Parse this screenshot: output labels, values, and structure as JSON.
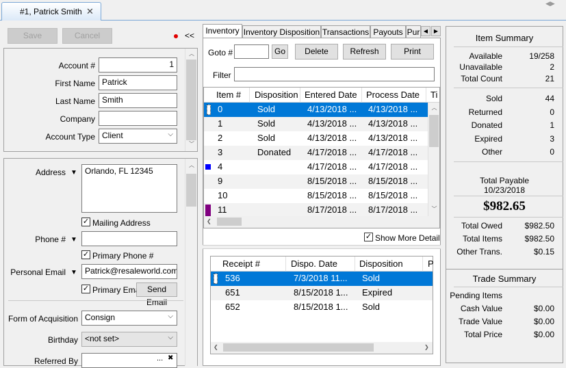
{
  "document_tab": {
    "title": "#1, Patrick Smith"
  },
  "left": {
    "save_label": "Save",
    "cancel_label": "Cancel",
    "collapse_label": "<<",
    "account_number_label": "Account #",
    "account_number_value": "1",
    "first_name_label": "First Name",
    "first_name_value": "Patrick",
    "last_name_label": "Last Name",
    "last_name_value": "Smith",
    "company_label": "Company",
    "company_value": "",
    "account_type_label": "Account Type",
    "account_type_value": "Client",
    "address_label": "Address",
    "address_value": "Orlando, FL  12345",
    "mailing_address_label": "Mailing Address",
    "phone_label": "Phone #",
    "phone_value": "",
    "primary_phone_label": "Primary Phone #",
    "personal_email_label": "Personal Email",
    "personal_email_value": "Patrick@resaleworld.com",
    "primary_email_label": "Primary Email",
    "send_email_label": "Send Email",
    "form_of_acquisition_label": "Form of Acquisition",
    "form_of_acquisition_value": "Consign",
    "birthday_label": "Birthday",
    "birthday_value": "<not set>",
    "referred_by_label": "Referred By",
    "referred_by_value": "",
    "ellipsis": "...",
    "clear": "✖"
  },
  "middle": {
    "tabs": [
      "Inventory",
      "Inventory Disposition",
      "Transactions",
      "Payouts",
      "Pur"
    ],
    "goto_label": "Goto #",
    "goto_value": "",
    "go_label": "Go",
    "delete_label": "Delete",
    "refresh_label": "Refresh",
    "print_label": "Print",
    "filter_label": "Filter",
    "filter_value": "",
    "inventory_columns": [
      "Item #",
      "Disposition",
      "Entered Date",
      "Process Date",
      "Ti"
    ],
    "inventory_rows": [
      {
        "item": "0",
        "disposition": "Sold",
        "entered": "4/13/2018 ...",
        "process": "4/13/2018 ..."
      },
      {
        "item": "1",
        "disposition": "Sold",
        "entered": "4/13/2018 ...",
        "process": "4/13/2018 ..."
      },
      {
        "item": "2",
        "disposition": "Sold",
        "entered": "4/13/2018 ...",
        "process": "4/13/2018 ..."
      },
      {
        "item": "3",
        "disposition": "Donated",
        "entered": "4/17/2018 ...",
        "process": "4/17/2018 ..."
      },
      {
        "item": "4",
        "disposition": "",
        "entered": "4/17/2018 ...",
        "process": "4/17/2018 ..."
      },
      {
        "item": "9",
        "disposition": "",
        "entered": "8/15/2018 ...",
        "process": "8/15/2018 ..."
      },
      {
        "item": "10",
        "disposition": "",
        "entered": "8/15/2018 ...",
        "process": "8/15/2018 ..."
      },
      {
        "item": "11",
        "disposition": "",
        "entered": "8/17/2018 ...",
        "process": "8/17/2018 ..."
      }
    ],
    "row_marker_colors": {
      "4": "#0000ff",
      "11": "#800080"
    },
    "show_more_detail_label": "Show More Detail",
    "receipt_columns": [
      "Receipt #",
      "Dispo. Date",
      "Disposition",
      "P"
    ],
    "receipt_rows": [
      {
        "receipt": "536",
        "date": "7/3/2018 11...",
        "disposition": "Sold"
      },
      {
        "receipt": "651",
        "date": "8/15/2018 1...",
        "disposition": "Expired"
      },
      {
        "receipt": "652",
        "date": "8/15/2018 1...",
        "disposition": "Sold"
      }
    ]
  },
  "summary": {
    "title": "Item Summary",
    "available_label": "Available",
    "available_value": "19/258",
    "unavailable_label": "Unavailable",
    "unavailable_value": "2",
    "total_count_label": "Total Count",
    "total_count_value": "21",
    "sold_label": "Sold",
    "sold_value": "44",
    "returned_label": "Returned",
    "returned_value": "0",
    "donated_label": "Donated",
    "donated_value": "1",
    "expired_label": "Expired",
    "expired_value": "3",
    "other_label": "Other",
    "other_value": "0",
    "total_payable_label": "Total Payable",
    "total_payable_date": "10/23/2018",
    "total_payable_value": "$982.65",
    "total_owed_label": "Total Owed",
    "total_owed_value": "$982.50",
    "total_items_label": "Total Items",
    "total_items_value": "$982.50",
    "other_trans_label": "Other Trans.",
    "other_trans_value": "$0.15",
    "trade_title": "Trade Summary",
    "pending_items_label": "Pending Items",
    "pending_items_value": "",
    "cash_value_label": "Cash Value",
    "cash_value_value": "$0.00",
    "trade_value_label": "Trade Value",
    "trade_value_value": "$0.00",
    "total_price_label": "Total Price",
    "total_price_value": "$0.00"
  },
  "colors": {
    "selection": "#0078d7",
    "accent_border": "#7aa7d6"
  }
}
